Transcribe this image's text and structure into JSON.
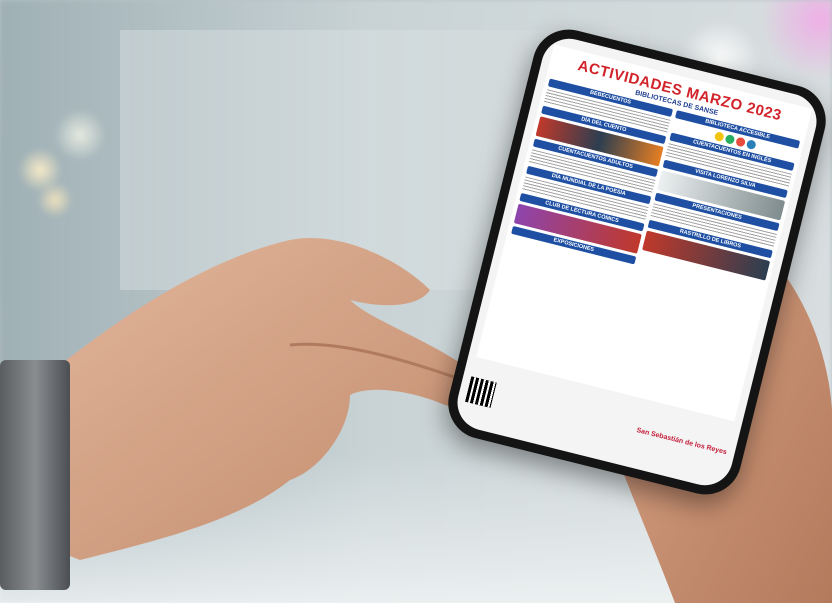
{
  "poster": {
    "title": "ACTIVIDADES MARZO 2023",
    "subtitle": "BIBLIOTECAS DE SANSE",
    "sections_left": [
      "BEBECUENTOS",
      "DÍA DEL CUENTO",
      "CUENTACUENTOS ADULTOS",
      "DÍA MUNDIAL DE LA POESÍA",
      "CLUB DE LECTURA CÓMICS",
      "EXPOSICIONES"
    ],
    "sections_right": [
      "BIBLIOTECA ACCESIBLE",
      "CUENTACUENTOS EN INGLÉS",
      "VISITA LORENZO SILVA",
      "PRESENTACIONES",
      "RASTRILLO DE LIBROS"
    ],
    "footer_logo": "San Sebastián de los Reyes",
    "colors": {
      "title": "#d2232a",
      "section": "#1e4fa3",
      "pink": "#e35fd0"
    }
  }
}
